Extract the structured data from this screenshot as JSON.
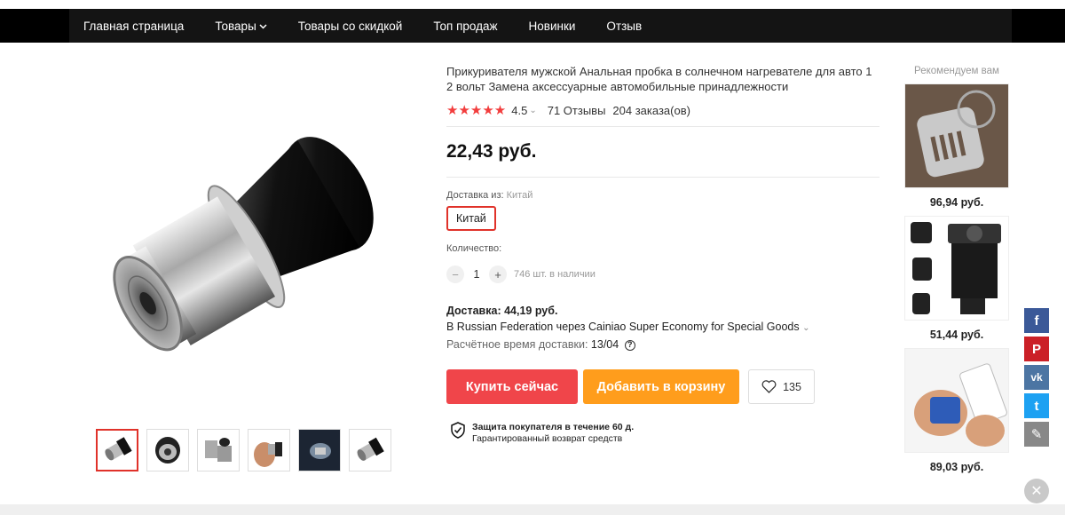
{
  "nav": {
    "items": [
      {
        "label": "Главная страница"
      },
      {
        "label": "Товары",
        "has_dropdown": true
      },
      {
        "label": "Товары со скидкой"
      },
      {
        "label": "Топ продаж"
      },
      {
        "label": "Новинки"
      },
      {
        "label": "Отзыв"
      }
    ]
  },
  "product": {
    "title": "Прикуривателя мужской Анальная пробка в солнечном нагревателе для авто 1 2 вольт Замена аксессуарные автомобильные принадлежности",
    "stars": "★★★★★",
    "rating": "4.5",
    "rating_chevron": "⌄",
    "reviews": "71 Отзывы",
    "orders": "204 заказа(ов)",
    "price": "22,43 руб.",
    "ship_from_label": "Доставка из:",
    "ship_from_value": "Китай",
    "country_option": "Китай",
    "quantity_label": "Количество:",
    "qty_minus": "−",
    "qty_plus": "+",
    "quantity_value": "1",
    "stock": "746 шт. в наличии",
    "delivery_label": "Доставка: 44,19 руб.",
    "delivery_method": "В Russian Federation через Cainiao Super Economy for Special Goods",
    "delivery_chevron": "⌄",
    "delivery_time_label": "Расчётное время доставки:",
    "delivery_time_value": "13/04",
    "buy_now": "Купить сейчас",
    "add_to_cart": "Добавить в корзину",
    "wishlist_count": "135",
    "protection_title": "Защита покупателя в течение 60 д.",
    "protection_sub": "Гарантированный возврат средств"
  },
  "recommendations": {
    "title": "Рекомендуем вам",
    "items": [
      {
        "price": "96,94 руб."
      },
      {
        "price": "51,44 руб."
      },
      {
        "price": "89,03 руб."
      }
    ]
  },
  "social": {
    "facebook": "f",
    "pinterest": "P",
    "vk": "vk",
    "twitter": "t",
    "edit": "✎"
  },
  "close": "✕",
  "colors": {
    "buy": "#f0454a",
    "cart": "#ff9d1c",
    "stars": "#f23d3d",
    "facebook": "#3b5998",
    "pinterest": "#cb2027",
    "vk": "#4c75a3",
    "twitter": "#1da1f2",
    "edit": "#888888"
  }
}
